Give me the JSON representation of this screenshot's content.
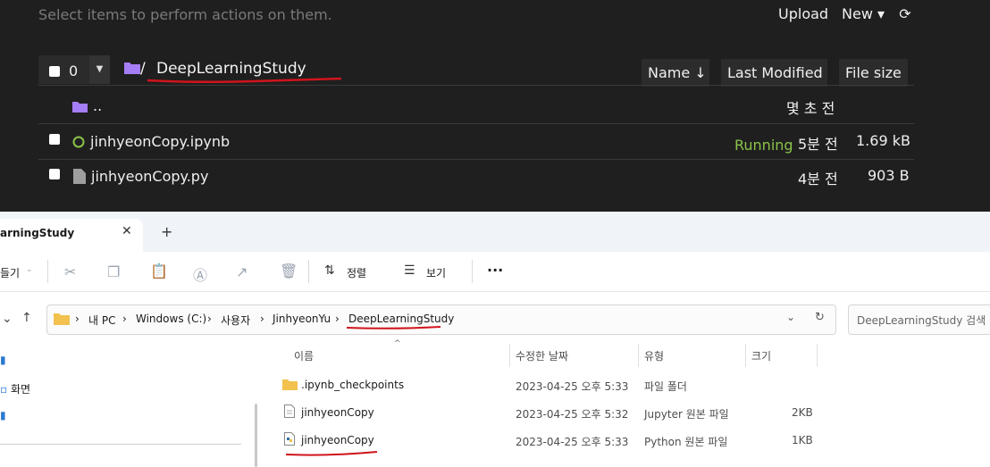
{
  "jupyter": {
    "hint": "Select items to perform actions on them.",
    "upload_label": "Upload",
    "new_label": "New ▾",
    "refresh_icon": "refresh-icon",
    "selected_count": "0",
    "current_dir": "DeepLearningStudy",
    "breadcrumb_sep": "/",
    "sort": {
      "name": "Name ↓",
      "last_modified": "Last Modified",
      "file_size": "File size"
    },
    "rows": [
      {
        "icon": "folder-icon",
        "name": "..",
        "modified": "몇 초 전",
        "size": "",
        "status": ""
      },
      {
        "icon": "notebook-running-icon",
        "name": "jinhyeonCopy.ipynb",
        "modified": "5분 전",
        "size": "1.69 kB",
        "status": "Running"
      },
      {
        "icon": "file-icon",
        "name": "jinhyeonCopy.py",
        "modified": "4분 전",
        "size": "903 B",
        "status": ""
      }
    ],
    "colors": {
      "folder": "#a57df5",
      "running": "#8bc34a",
      "underline": "#d0141c"
    }
  },
  "explorer": {
    "tab_title": "arningStudy",
    "cmd": {
      "new_partial": "들기",
      "sort": "정렬",
      "view": "보기"
    },
    "address": [
      "내 PC",
      "Windows (C:)",
      "사용자",
      "JinhyeonYu",
      "DeepLearningStudy"
    ],
    "search_placeholder": "DeepLearningStudy 검색",
    "columns": {
      "name": "이름",
      "modified": "수정한 날짜",
      "type": "유형",
      "size": "크기"
    },
    "sidebar": {
      "item_desktop": "화면"
    },
    "files": [
      {
        "icon": "folder-icon",
        "name": ".ipynb_checkpoints",
        "modified": "2023-04-25 오후 5:33",
        "type": "파일 폴더",
        "size": ""
      },
      {
        "icon": "document-icon",
        "name": "jinhyeonCopy",
        "modified": "2023-04-25 오후 5:32",
        "type": "Jupyter 원본 파일",
        "size": "2KB"
      },
      {
        "icon": "python-file-icon",
        "name": "jinhyeonCopy",
        "modified": "2023-04-25 오후 5:33",
        "type": "Python 원본 파일",
        "size": "1KB"
      }
    ]
  }
}
